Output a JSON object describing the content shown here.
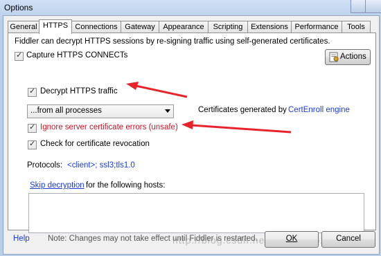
{
  "window": {
    "title": "Options"
  },
  "tabs": [
    {
      "label": "General"
    },
    {
      "label": "HTTPS"
    },
    {
      "label": "Connections"
    },
    {
      "label": "Gateway"
    },
    {
      "label": "Appearance"
    },
    {
      "label": "Scripting"
    },
    {
      "label": "Extensions"
    },
    {
      "label": "Performance"
    },
    {
      "label": "Tools"
    }
  ],
  "https": {
    "intro": "Fiddler can decrypt HTTPS sessions by re-signing traffic using self-generated certificates.",
    "capture_label": "Capture HTTPS CONNECTs",
    "capture_checked": true,
    "actions_label": "Actions",
    "decrypt_label": "Decrypt HTTPS traffic",
    "decrypt_checked": true,
    "process_select": "...from all processes",
    "cert_prefix": "Certificates generated by ",
    "cert_link": "CertEnroll engine",
    "ignore_label": "Ignore server certificate errors (unsafe)",
    "ignore_checked": true,
    "revocation_label": "Check for certificate revocation",
    "revocation_checked": true,
    "protocols_label": "Protocols: ",
    "protocols_value": "<client>; ssl3;tls1.0",
    "skip_link": "Skip decryption",
    "skip_rest": " for the following hosts:",
    "hosts_value": ""
  },
  "footer": {
    "help": "Help",
    "note": "Note: Changes may not take effect until Fiddler is restarted.",
    "ok": "OK",
    "cancel": "Cancel"
  },
  "watermark": "http://blog.csdn.net/u012220520",
  "colors": {
    "link": "#1a3cd4",
    "warning": "#c0162a",
    "annotation_arrow": "#e8232a"
  }
}
